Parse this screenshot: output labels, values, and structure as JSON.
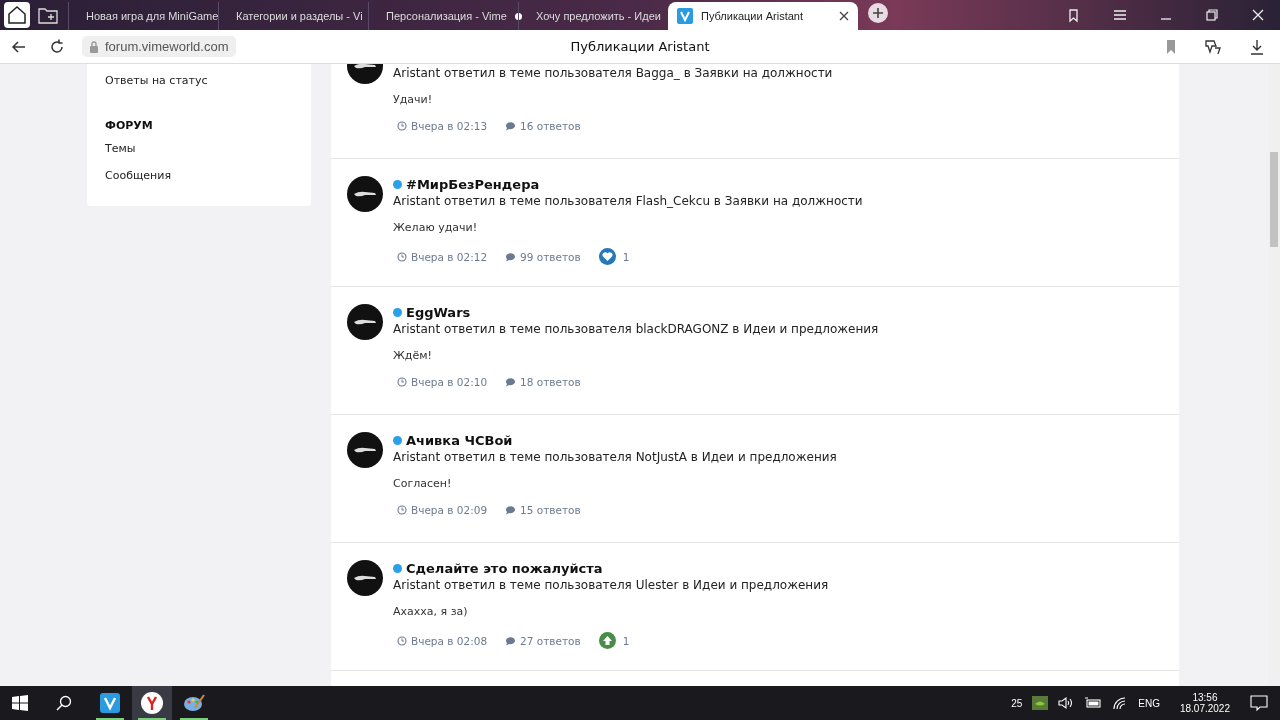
{
  "browser": {
    "tabs": [
      {
        "title": "Новая игра для MiniGame",
        "selected": false,
        "dot": false
      },
      {
        "title": "Категории и разделы - Vi",
        "selected": false,
        "dot": false
      },
      {
        "title": "Персонализация - Vime",
        "selected": false,
        "dot": true
      },
      {
        "title": "Хочу предложить - Идеи",
        "selected": false,
        "dot": false
      },
      {
        "title": "Публикации Aristant",
        "selected": true,
        "dot": false
      }
    ],
    "address": "forum.vimeworld.com",
    "page_title": "Публикации Aristant"
  },
  "sidebar": {
    "items": [
      {
        "kind": "link",
        "label": "Ответы на статус"
      },
      {
        "kind": "heading",
        "label": "ФОРУМ"
      },
      {
        "kind": "link",
        "label": "Темы"
      },
      {
        "kind": "link",
        "label": "Сообщения"
      }
    ]
  },
  "posts": [
    {
      "kind": "full",
      "summary": "Aristant ответил в теме пользователя Bagga_ в Заявки на должности",
      "message": "Удачи!",
      "time": "Вчера в 02:13",
      "replies": "16 ответов"
    },
    {
      "title": "#МирБезРендера",
      "summary": "Aristant ответил в теме пользователя Flash_Cekcu в Заявки на должности",
      "message": "Желаю удачи!",
      "time": "Вчера в 02:12",
      "kind": "full",
      "replies": "99 ответов",
      "reaction": {
        "kind": "like",
        "count": "1"
      }
    },
    {
      "title": "EggWars",
      "summary": "Aristant ответил в теме пользователя blackDRAGONZ в Идеи и предложения",
      "message": "Ждём!",
      "time": "Вчера в 02:10",
      "kind": "full",
      "replies": "18 ответов"
    },
    {
      "title": "Ачивка ЧСВой",
      "summary": "Aristant ответил в теме пользователя NotJustA в Идеи и предложения",
      "message": "Согласен!",
      "time": "Вчера в 02:09",
      "kind": "full",
      "replies": "15 ответов"
    },
    {
      "title": "Сделайте это пожалуйста",
      "summary": "Aristant ответил в теме пользователя Ulester в Идеи и предложения",
      "message": "Ахахха, я за)",
      "time": "Вчера в 02:08",
      "kind": "full",
      "replies": "27 ответов",
      "reaction": {
        "kind": "upvote",
        "count": "1"
      }
    },
    {
      "kind": "cut"
    }
  ],
  "taskbar": {
    "apps": [
      {
        "kind": "vime",
        "selected": false
      },
      {
        "kind": "yandex",
        "selected": true
      },
      {
        "kind": "paint",
        "selected": false
      }
    ],
    "tray_count": "25",
    "language": "ENG",
    "time": "13:56",
    "date": "18.07.2022"
  }
}
